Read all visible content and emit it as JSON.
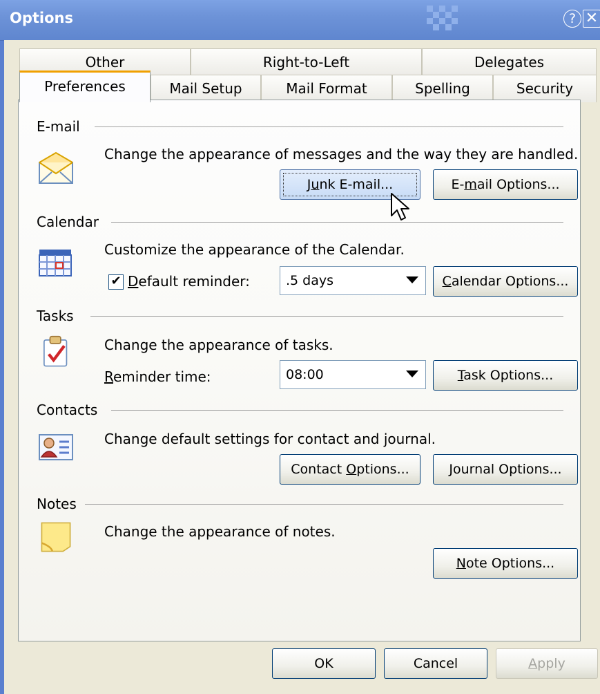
{
  "window": {
    "title": "Options"
  },
  "tabs_back": [
    "Other",
    "Right-to-Left",
    "Delegates"
  ],
  "tabs_front": [
    "Preferences",
    "Mail Setup",
    "Mail Format",
    "Spelling",
    "Security"
  ],
  "email": {
    "label": "E-mail",
    "description": "Change the appearance of messages and the way they are handled.",
    "junk_pre": "J",
    "junk_ul": "u",
    "junk_post": "nk E-mail...",
    "opts_pre": "E-",
    "opts_ul": "m",
    "opts_post": "ail Options...",
    "icon": "envelope-icon"
  },
  "calendar": {
    "label": "Calendar",
    "description": "Customize the appearance of the Calendar.",
    "reminder_checked": true,
    "reminder_ul": "D",
    "reminder_post": "efault reminder:",
    "reminder_value": ".5 days",
    "btn_ul": "C",
    "btn_post": "alendar Options...",
    "icon": "calendar-icon"
  },
  "tasks": {
    "label": "Tasks",
    "description": "Change the appearance of tasks.",
    "reminder_ul": "R",
    "reminder_post": "eminder time:",
    "reminder_value": "08:00",
    "btn_ul": "T",
    "btn_post": "ask Options...",
    "icon": "task-clipboard-icon"
  },
  "contacts": {
    "label": "Contacts",
    "description": "Change default settings for contact and journal.",
    "contact_pre": "Contact ",
    "contact_ul": "O",
    "contact_post": "ptions...",
    "journal_ul": "J",
    "journal_post": "ournal Options...",
    "icon": "contact-card-icon"
  },
  "notes": {
    "label": "Notes",
    "description": "Change the appearance of notes.",
    "btn_ul": "N",
    "btn_post": "ote Options...",
    "icon": "sticky-note-icon"
  },
  "footer": {
    "ok": "OK",
    "cancel": "Cancel",
    "apply_ul": "A",
    "apply_post": "pply"
  },
  "colors": {
    "titlebar": "#6d93d8",
    "dialog_bg": "#ece9d8",
    "active_tab_accent": "#f0a000"
  }
}
